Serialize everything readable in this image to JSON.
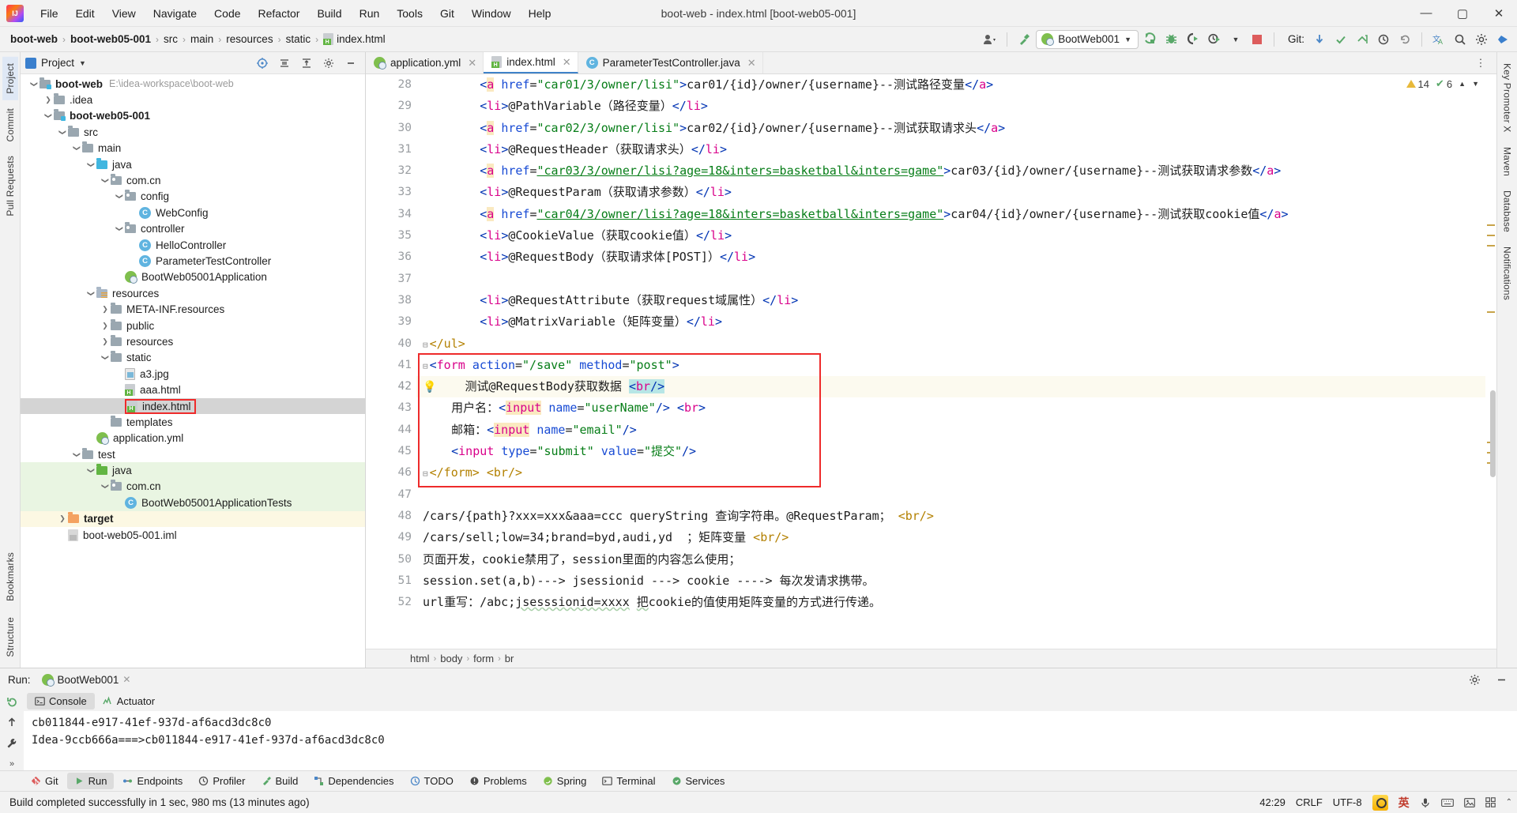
{
  "window": {
    "title": "boot-web - index.html [boot-web05-001]",
    "minimize": "—",
    "maximize": "▢",
    "close": "✕"
  },
  "menubar": [
    "File",
    "Edit",
    "View",
    "Navigate",
    "Code",
    "Refactor",
    "Build",
    "Run",
    "Tools",
    "Git",
    "Window",
    "Help"
  ],
  "breadcrumb": {
    "items": [
      "boot-web",
      "boot-web05-001",
      "src",
      "main",
      "resources",
      "static",
      "index.html"
    ],
    "separator": "›"
  },
  "toolbar": {
    "run_config": "BootWeb001",
    "git_label": "Git:",
    "icons": [
      "user-avatar-icon",
      "hammer-icon",
      "run-icon",
      "debug-icon",
      "coverage-icon",
      "profiler-icon",
      "stop-icon",
      "git-update-icon",
      "git-commit-icon",
      "git-push-icon",
      "git-history-icon",
      "git-rollback-icon",
      "translate-icon",
      "search-icon",
      "settings-icon",
      "search-everywhere-icon"
    ]
  },
  "left_strip": {
    "tabs": [
      "Project",
      "Commit",
      "Pull Requests"
    ],
    "bottom": [
      "Bookmarks",
      "Structure"
    ]
  },
  "right_strip": {
    "tabs": [
      "Key Promoter X",
      "Maven",
      "Database",
      "Notifications"
    ]
  },
  "project_panel": {
    "title": "Project",
    "tree": [
      {
        "depth": 0,
        "chev": "v",
        "icon": "module-folder-icon",
        "label": "boot-web",
        "bold": true,
        "path": "E:\\idea-workspace\\boot-web"
      },
      {
        "depth": 1,
        "chev": ">",
        "icon": "folder-icon",
        "label": ".idea"
      },
      {
        "depth": 1,
        "chev": "v",
        "icon": "module-folder-icon",
        "label": "boot-web05-001",
        "bold": true
      },
      {
        "depth": 2,
        "chev": "v",
        "icon": "folder-icon",
        "label": "src"
      },
      {
        "depth": 3,
        "chev": "v",
        "icon": "folder-icon",
        "label": "main"
      },
      {
        "depth": 4,
        "chev": "v",
        "icon": "source-folder-icon",
        "label": "java"
      },
      {
        "depth": 5,
        "chev": "v",
        "icon": "package-icon",
        "label": "com.cn"
      },
      {
        "depth": 6,
        "chev": "v",
        "icon": "package-icon",
        "label": "config"
      },
      {
        "depth": 7,
        "chev": "",
        "icon": "java-class-icon",
        "label": "WebConfig"
      },
      {
        "depth": 6,
        "chev": "v",
        "icon": "package-icon",
        "label": "controller"
      },
      {
        "depth": 7,
        "chev": "",
        "icon": "java-class-icon",
        "label": "HelloController"
      },
      {
        "depth": 7,
        "chev": "",
        "icon": "java-class-icon",
        "label": "ParameterTestController"
      },
      {
        "depth": 6,
        "chev": "",
        "icon": "spring-boot-icon",
        "label": "BootWeb05001Application"
      },
      {
        "depth": 4,
        "chev": "v",
        "icon": "resources-folder-icon",
        "label": "resources"
      },
      {
        "depth": 5,
        "chev": ">",
        "icon": "folder-icon",
        "label": "META-INF.resources"
      },
      {
        "depth": 5,
        "chev": ">",
        "icon": "folder-icon",
        "label": "public"
      },
      {
        "depth": 5,
        "chev": ">",
        "icon": "folder-icon",
        "label": "resources"
      },
      {
        "depth": 5,
        "chev": "v",
        "icon": "folder-icon",
        "label": "static"
      },
      {
        "depth": 6,
        "chev": "",
        "icon": "image-file-icon",
        "label": "a3.jpg"
      },
      {
        "depth": 6,
        "chev": "",
        "icon": "html-file-icon",
        "label": "aaa.html"
      },
      {
        "depth": 6,
        "chev": "",
        "icon": "html-file-icon",
        "label": "index.html",
        "selected": true,
        "highlight": true
      },
      {
        "depth": 5,
        "chev": "",
        "icon": "folder-icon",
        "label": "templates"
      },
      {
        "depth": 4,
        "chev": "",
        "icon": "yaml-file-icon",
        "label": "application.yml"
      },
      {
        "depth": 3,
        "chev": "v",
        "icon": "folder-icon",
        "label": "test"
      },
      {
        "depth": 4,
        "chev": "v",
        "icon": "test-source-folder-icon",
        "label": "java",
        "rowbg": "green"
      },
      {
        "depth": 5,
        "chev": "v",
        "icon": "package-icon",
        "label": "com.cn",
        "rowbg": "green"
      },
      {
        "depth": 6,
        "chev": "",
        "icon": "test-class-icon",
        "label": "BootWeb05001ApplicationTests",
        "rowbg": "green"
      },
      {
        "depth": 2,
        "chev": ">",
        "icon": "target-folder-icon",
        "label": "target",
        "bold": true,
        "rowbg": "yellow"
      },
      {
        "depth": 2,
        "chev": "",
        "icon": "iml-file-icon",
        "label": "boot-web05-001.iml"
      }
    ]
  },
  "editor": {
    "tabs": [
      {
        "label": "application.yml",
        "icon": "yaml-file-icon",
        "active": false
      },
      {
        "label": "index.html",
        "icon": "html-file-icon",
        "active": true
      },
      {
        "label": "ParameterTestController.java",
        "icon": "java-class-icon",
        "active": false
      }
    ],
    "inspection": {
      "warnings": "14",
      "weak_warnings": "6",
      "warn_icon": "warning-triangle-icon",
      "ok_icon": "checkmark-icon"
    },
    "first_line_number": 28,
    "lines": [
      {
        "n": 28,
        "html": "<span class='t-plain'>        </span><span class='t-tag'>&lt;</span><span class='hl-yellow t-tagname'>a</span> <span class='t-attr'>href</span><span class='t-plain'>=</span><span class='t-val'>\"car01/3/owner/lisi\"</span><span class='t-tag'>&gt;</span><span class='t-plain'>car01/{id}/owner/{username}--测试路径变量</span><span class='t-tag'>&lt;/</span><span class='t-tagname'>a</span><span class='t-tag'>&gt;</span>"
      },
      {
        "n": 29,
        "html": "<span class='t-plain'>        </span><span class='t-tag'>&lt;</span><span class='t-tagname'>li</span><span class='t-tag'>&gt;</span><span class='t-plain'>@PathVariable（路径变量）</span><span class='t-tag'>&lt;/</span><span class='t-tagname'>li</span><span class='t-tag'>&gt;</span>"
      },
      {
        "n": 30,
        "html": "<span class='t-plain'>        </span><span class='t-tag'>&lt;</span><span class='hl-yellow t-tagname'>a</span> <span class='t-attr'>href</span><span class='t-plain'>=</span><span class='t-val'>\"car02/3/owner/lisi\"</span><span class='t-tag'>&gt;</span><span class='t-plain'>car02/{id}/owner/{username}--测试获取请求头</span><span class='t-tag'>&lt;/</span><span class='t-tagname'>a</span><span class='t-tag'>&gt;</span>"
      },
      {
        "n": 31,
        "html": "<span class='t-plain'>        </span><span class='t-tag'>&lt;</span><span class='t-tagname'>li</span><span class='t-tag'>&gt;</span><span class='t-plain'>@RequestHeader（获取请求头）</span><span class='t-tag'>&lt;/</span><span class='t-tagname'>li</span><span class='t-tag'>&gt;</span>"
      },
      {
        "n": 32,
        "html": "<span class='t-plain'>        </span><span class='t-tag'>&lt;</span><span class='hl-yellow t-tagname'>a</span> <span class='t-attr'>href</span><span class='t-plain'>=</span><span class='t-val ulink'>\"car03/3/owner/lisi?age=18&amp;inters=basketball&amp;inters=game\"</span><span class='t-tag'>&gt;</span><span class='t-plain'>car03/{id}/owner/{username}--测试获取请求参数</span><span class='t-tag'>&lt;/</span><span class='t-tagname'>a</span><span class='t-tag'>&gt;</span>"
      },
      {
        "n": 33,
        "html": "<span class='t-plain'>        </span><span class='t-tag'>&lt;</span><span class='t-tagname'>li</span><span class='t-tag'>&gt;</span><span class='t-plain'>@RequestParam（获取请求参数）</span><span class='t-tag'>&lt;/</span><span class='t-tagname'>li</span><span class='t-tag'>&gt;</span>"
      },
      {
        "n": 34,
        "html": "<span class='t-plain'>        </span><span class='t-tag'>&lt;</span><span class='hl-yellow t-tagname'>a</span> <span class='t-attr'>href</span><span class='t-plain'>=</span><span class='t-val ulink'>\"car04/3/owner/lisi?age=18&amp;inters=basketball&amp;inters=game\"</span><span class='t-tag'>&gt;</span><span class='t-plain'>car04/{id}/owner/{username}--测试获取cookie值</span><span class='t-tag'>&lt;/</span><span class='t-tagname'>a</span><span class='t-tag'>&gt;</span>"
      },
      {
        "n": 35,
        "html": "<span class='t-plain'>        </span><span class='t-tag'>&lt;</span><span class='t-tagname'>li</span><span class='t-tag'>&gt;</span><span class='t-plain'>@CookieValue（获取cookie值）</span><span class='t-tag'>&lt;/</span><span class='t-tagname'>li</span><span class='t-tag'>&gt;</span>"
      },
      {
        "n": 36,
        "html": "<span class='t-plain'>        </span><span class='t-tag'>&lt;</span><span class='t-tagname'>li</span><span class='t-tag'>&gt;</span><span class='t-plain'>@RequestBody（获取请求体[POST]）</span><span class='t-tag'>&lt;/</span><span class='t-tagname'>li</span><span class='t-tag'>&gt;</span>"
      },
      {
        "n": 37,
        "html": ""
      },
      {
        "n": 38,
        "html": "<span class='t-plain'>        </span><span class='t-tag'>&lt;</span><span class='t-tagname'>li</span><span class='t-tag'>&gt;</span><span class='t-plain'>@RequestAttribute（获取request域属性）</span><span class='t-tag'>&lt;/</span><span class='t-tagname'>li</span><span class='t-tag'>&gt;</span>"
      },
      {
        "n": 39,
        "html": "<span class='t-plain'>        </span><span class='t-tag'>&lt;</span><span class='t-tagname'>li</span><span class='t-tag'>&gt;</span><span class='t-plain'>@MatrixVariable（矩阵变量）</span><span class='t-tag'>&lt;/</span><span class='t-tagname'>li</span><span class='t-tag'>&gt;</span>"
      },
      {
        "n": 40,
        "html": "<span class='t-punc'>&lt;/ul&gt;</span>",
        "fold": "minus"
      },
      {
        "n": 41,
        "html": "<span class='t-tag'>&lt;</span><span class='t-tagname'>form</span> <span class='t-attr'>action</span><span class='t-plain'>=</span><span class='t-val'>\"/save\"</span> <span class='t-attr'>method</span><span class='t-plain'>=</span><span class='t-val'>\"post\"</span><span class='t-tag'>&gt;</span>",
        "fold": "plus"
      },
      {
        "n": 42,
        "html": "<span class='t-plain'>    测试@RequestBody获取数据 </span><span class='hl-cyan t-tag'>&lt;</span><span class='hl-cyan t-tagname'>br</span><span class='hl-cyan t-tag'>/&gt;</span>",
        "highlight": true,
        "bulb": true
      },
      {
        "n": 43,
        "html": "<span class='t-plain'>    用户名：</span><span class='t-tag'>&lt;</span><span class='hl-yellow t-tagname'>input</span> <span class='t-attr'>name</span><span class='t-plain'>=</span><span class='t-val'>\"userName\"</span><span class='t-tag'>/&gt;</span> <span class='t-tag'>&lt;</span><span class='t-tagname'>br</span><span class='t-tag'>&gt;</span>"
      },
      {
        "n": 44,
        "html": "<span class='t-plain'>    邮箱：</span><span class='t-tag'>&lt;</span><span class='hl-yellow t-tagname'>input</span> <span class='t-attr'>name</span><span class='t-plain'>=</span><span class='t-val'>\"email\"</span><span class='t-tag'>/&gt;</span>"
      },
      {
        "n": 45,
        "html": "<span class='t-plain'>    </span><span class='t-tag'>&lt;</span><span class='t-tagname'>input</span> <span class='t-attr'>type</span><span class='t-plain'>=</span><span class='t-val'>\"submit\"</span> <span class='t-attr'>value</span><span class='t-plain'>=</span><span class='t-val'>\"提交\"</span><span class='t-tag'>/&gt;</span>"
      },
      {
        "n": 46,
        "html": "<span class='t-punc'>&lt;/form&gt;</span> <span class='t-punc'>&lt;br/&gt;</span>",
        "fold": "minus"
      },
      {
        "n": 47,
        "html": ""
      },
      {
        "n": 48,
        "html": "<span class='t-plain'>/cars/{path}?xxx=xxx&amp;aaa=ccc queryString 查询字符串。@RequestParam；</span> <span class='t-punc'>&lt;br/&gt;</span>"
      },
      {
        "n": 49,
        "html": "<span class='t-plain'>/cars/sell;low=34;brand=byd,audi,yd  ；矩阵变量</span> <span class='t-punc'>&lt;br/&gt;</span>"
      },
      {
        "n": 50,
        "html": "<span class='t-plain'>页面开发，cookie禁用了，session里面的内容怎么使用；</span>"
      },
      {
        "n": 51,
        "html": "<span class='t-plain'>session.set(a,b)---&gt; jsessionid ---&gt; cookie ----&gt; 每次发请求携带。</span>"
      },
      {
        "n": 52,
        "html": "<span class='t-plain'>url重写：/abc;</span><span class='t-plain wavy'>jsesssionid=xxxx</span><span class='t-plain'> </span><span class='t-plain wavy'>把</span><span class='t-plain'>cookie的值使用矩阵变量的方式进行传递。</span>"
      }
    ],
    "breadcrumbs": [
      "html",
      "body",
      "form",
      "br"
    ],
    "crumb_sep": "›"
  },
  "run_panel": {
    "label": "Run:",
    "config_name": "BootWeb001",
    "close": "✕",
    "subtabs": [
      {
        "label": "Console",
        "icon": "console-icon",
        "selected": true
      },
      {
        "label": "Actuator",
        "icon": "actuator-icon",
        "selected": false
      }
    ],
    "console_lines": [
      "cb011844-e917-41ef-937d-af6acd3dc8c0",
      "Idea-9ccb666a===>cb011844-e917-41ef-937d-af6acd3dc8c0"
    ],
    "settings_icon": "gear-icon",
    "minimize_icon": "minimize-icon"
  },
  "tool_windows": [
    {
      "label": "Git",
      "icon": "git-icon",
      "selected": false
    },
    {
      "label": "Run",
      "icon": "run-icon",
      "selected": true
    },
    {
      "label": "Endpoints",
      "icon": "endpoints-icon",
      "selected": false
    },
    {
      "label": "Profiler",
      "icon": "profiler-icon",
      "selected": false
    },
    {
      "label": "Build",
      "icon": "build-icon",
      "selected": false
    },
    {
      "label": "Dependencies",
      "icon": "dependencies-icon",
      "selected": false
    },
    {
      "label": "TODO",
      "icon": "todo-icon",
      "selected": false
    },
    {
      "label": "Problems",
      "icon": "problems-icon",
      "selected": false
    },
    {
      "label": "Spring",
      "icon": "spring-icon",
      "selected": false
    },
    {
      "label": "Terminal",
      "icon": "terminal-icon",
      "selected": false
    },
    {
      "label": "Services",
      "icon": "services-icon",
      "selected": false
    }
  ],
  "statusbar": {
    "message": "Build completed successfully in 1 sec, 980 ms (13 minutes ago)",
    "caret": "42:29",
    "line_sep": "CRLF",
    "encoding": "UTF-8",
    "ime_lang": "英",
    "sogou_icon": "sogou-pinyin-icon",
    "tray_icons": [
      "mic-icon",
      "keyboard-icon",
      "image-icon",
      "grid-icon",
      "chevron-icon"
    ]
  }
}
